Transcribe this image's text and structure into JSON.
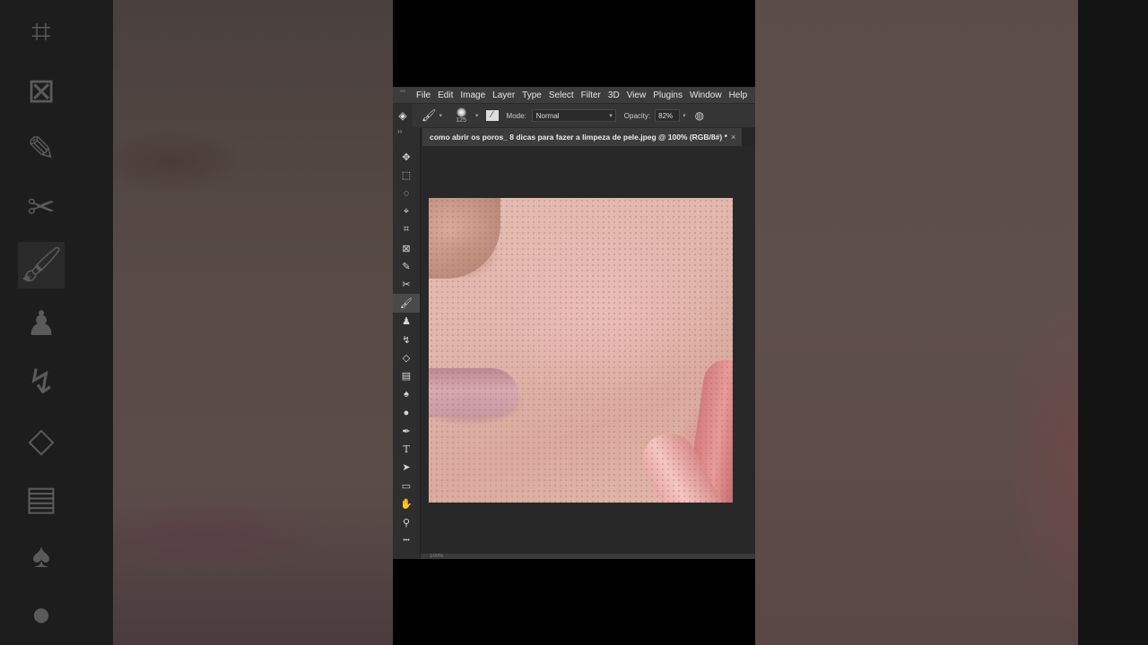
{
  "menubar": {
    "items": [
      "File",
      "Edit",
      "Image",
      "Layer",
      "Type",
      "Select",
      "Filter",
      "3D",
      "View",
      "Plugins",
      "Window",
      "Help"
    ]
  },
  "options_bar": {
    "brush_size": "125",
    "mode_label": "Mode:",
    "mode_value": "Normal",
    "opacity_label": "Opacity:",
    "opacity_value": "82%"
  },
  "document": {
    "tab_title": "como abrir os poros_ 8 dicas para fazer a limpeza de pele.jpeg @ 100% (RGB/8#) *",
    "close_symbol": "×",
    "zoom": "100%"
  },
  "toolbar": {
    "tools": [
      {
        "name": "move-tool",
        "icon": "✥"
      },
      {
        "name": "marquee-tool",
        "icon": "⬚"
      },
      {
        "name": "lasso-tool",
        "icon": "◌"
      },
      {
        "name": "quick-selection-tool",
        "icon": "⌖"
      },
      {
        "name": "crop-tool",
        "icon": "⌗"
      },
      {
        "name": "frame-tool",
        "icon": "⊠"
      },
      {
        "name": "eyedropper-tool",
        "icon": "✎"
      },
      {
        "name": "healing-tool",
        "icon": "✂"
      },
      {
        "name": "brush-tool",
        "icon": "🖌",
        "active": true
      },
      {
        "name": "clone-stamp-tool",
        "icon": "♟"
      },
      {
        "name": "history-brush-tool",
        "icon": "↯"
      },
      {
        "name": "eraser-tool",
        "icon": "◇"
      },
      {
        "name": "gradient-tool",
        "icon": "▤"
      },
      {
        "name": "blur-tool",
        "icon": "♠"
      },
      {
        "name": "dodge-tool",
        "icon": "●"
      },
      {
        "name": "pen-tool",
        "icon": "✒"
      },
      {
        "name": "type-tool",
        "icon": "T"
      },
      {
        "name": "path-selection-tool",
        "icon": "➤"
      },
      {
        "name": "rectangle-tool",
        "icon": "▭"
      },
      {
        "name": "hand-tool",
        "icon": "✋"
      },
      {
        "name": "zoom-tool",
        "icon": "⚲"
      },
      {
        "name": "more-tools",
        "icon": "•••"
      }
    ]
  }
}
